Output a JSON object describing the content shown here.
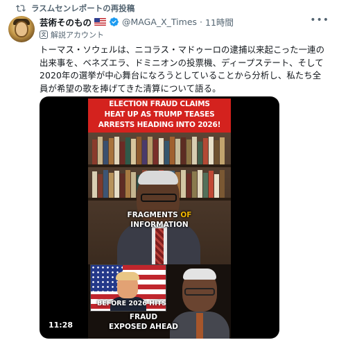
{
  "repost": {
    "label": "ラスムセンレポートの再投稿",
    "icon": "repost-icon"
  },
  "author": {
    "name": "芸術そのもの",
    "flag": "us-flag-emoji",
    "verified": true,
    "handle": "@MAGA_X_Times",
    "separator": "·",
    "time": "11時間",
    "more_icon": "more-icon"
  },
  "translate": {
    "label": "解説アカウント",
    "icon": "translate-icon"
  },
  "tweet": {
    "text": "トーマス・ソウェルは、ニコラス・マドゥーロの逮捕以来起こった一連の出来事を、ベネズエラ、ドミニオンの投票機、ディープステート、そして2020年の選挙が中心舞台になろうとしていることから分析し、私たち全員が希望の歌を捧げてきた清算について語る。"
  },
  "video": {
    "headline_lines": [
      "ELECTION FRAUD CLAIMS",
      "HEAT UP AS TRUMP TEASES",
      "ARRESTS HEADING INTO 2026!"
    ],
    "caption_part1": "FRAGMENTS ",
    "caption_accent": "OF",
    "caption_part2": "INFORMATION",
    "inset_caption": "BEFORE 2026 HITS",
    "lower_caption_line1": "FRAUD",
    "lower_caption_line2": "EXPOSED AHEAD",
    "duration": "11:28"
  },
  "colors": {
    "text_primary": "#0f1419",
    "text_secondary": "#536471",
    "verified_blue": "#1d9bf0",
    "headline_red": "#d4221e",
    "accent_yellow": "#f5b800"
  }
}
